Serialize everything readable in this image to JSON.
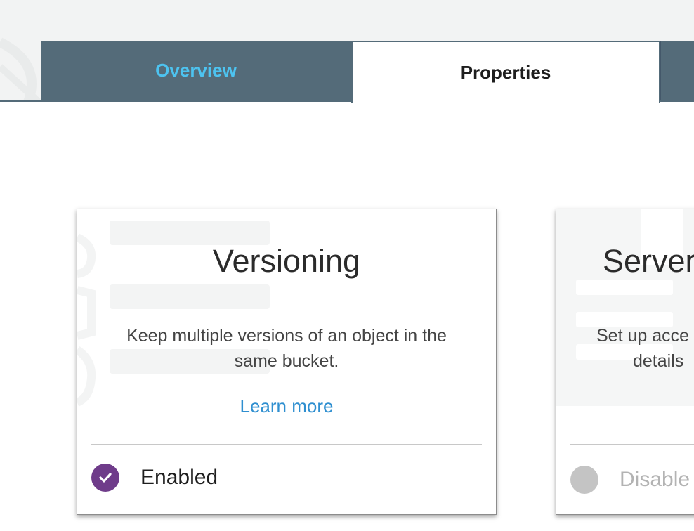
{
  "tabs": {
    "overview": "Overview",
    "properties": "Properties",
    "active": "properties"
  },
  "cards": {
    "versioning": {
      "title": "Versioning",
      "description": "Keep multiple versions of an object in the same bucket.",
      "learn_more": "Learn more",
      "status": "Enabled",
      "status_icon": "check-icon",
      "status_color": "#6f3c8a"
    },
    "server": {
      "title": "Server",
      "description_line1": "Set up acce",
      "description_line2": "details",
      "status": "Disable",
      "status_color": "#c4c4c4"
    }
  },
  "colors": {
    "tab_bar": "#546b79",
    "tab_overview_text": "#4dc3f0",
    "link": "#2f8fd0"
  }
}
